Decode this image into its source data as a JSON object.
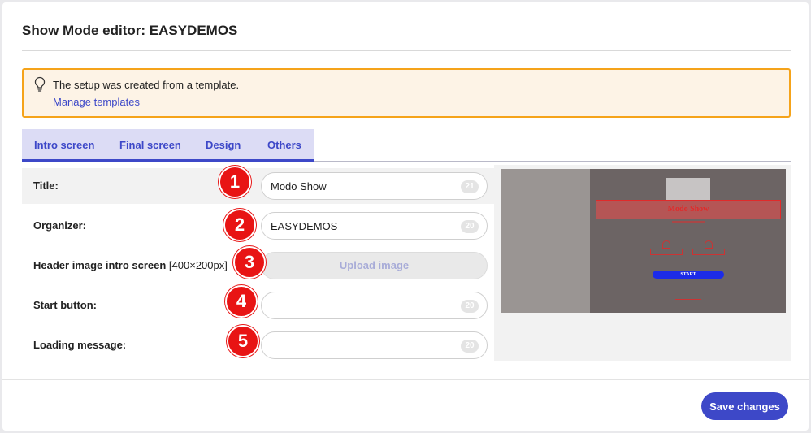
{
  "modal": {
    "title": "Show Mode editor: EASYDEMOS"
  },
  "notice": {
    "icon": "lightbulb-icon",
    "message": "The setup was created from a template.",
    "link": "Manage templates",
    "accent": "#f5a31a"
  },
  "tabs": [
    {
      "label": "Intro screen",
      "active": true
    },
    {
      "label": "Final screen",
      "active": false
    },
    {
      "label": "Design",
      "active": false
    },
    {
      "label": "Others",
      "active": false
    }
  ],
  "form": {
    "title": {
      "label": "Title:",
      "value": "Modo Show",
      "count": "21",
      "badge": "1"
    },
    "organizer": {
      "label": "Organizer:",
      "value": "EASYDEMOS",
      "count": "20",
      "badge": "2"
    },
    "header_image": {
      "label": "Header image intro screen",
      "hint": "[400×200px]",
      "button": "Upload image",
      "badge": "3"
    },
    "start_button": {
      "label": "Start button:",
      "value": "",
      "count": "20",
      "badge": "4"
    },
    "loading": {
      "label": "Loading message:",
      "value": "",
      "count": "20",
      "badge": "5"
    }
  },
  "preview": {
    "title_text": "Modo Show",
    "start_text": "START"
  },
  "footer": {
    "save_label": "Save changes"
  },
  "colors": {
    "primary": "#3d48c8",
    "badge": "#e81414",
    "notice_bg": "#fdf3e6"
  }
}
